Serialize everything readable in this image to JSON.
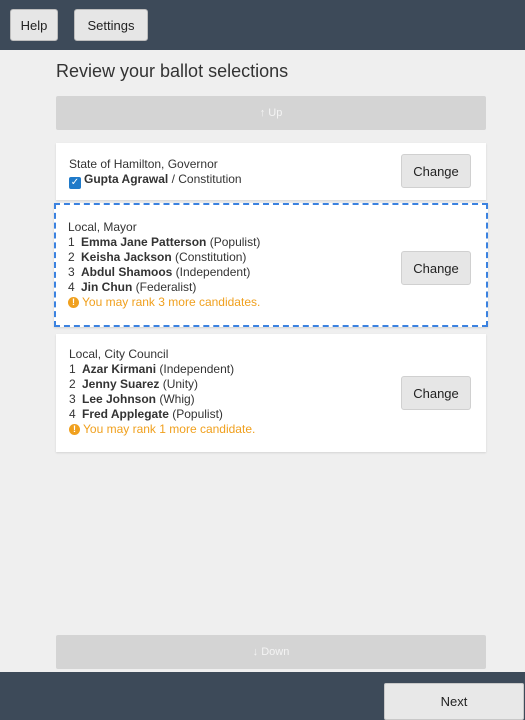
{
  "header": {
    "help_label": "Help",
    "settings_label": "Settings"
  },
  "page_title": "Review your ballot selections",
  "scroll_up_label": "Up",
  "scroll_down_label": "Down",
  "contests": [
    {
      "title": "State of Hamilton, Governor",
      "selection": {
        "name": "Gupta Agrawal",
        "party": " / Constitution"
      },
      "change_label": "Change"
    },
    {
      "title": "Local, Mayor",
      "rankings": [
        {
          "rank": "1",
          "name": "Emma Jane Patterson",
          "party": " (Populist)"
        },
        {
          "rank": "2",
          "name": "Keisha Jackson",
          "party": " (Constitution)"
        },
        {
          "rank": "3",
          "name": "Abdul Shamoos",
          "party": " (Independent)"
        },
        {
          "rank": "4",
          "name": "Jin Chun",
          "party": " (Federalist)"
        }
      ],
      "warning": "You may rank 3 more candidates.",
      "change_label": "Change"
    },
    {
      "title": "Local, City Council",
      "rankings": [
        {
          "rank": "1",
          "name": "Azar Kirmani",
          "party": " (Independent)"
        },
        {
          "rank": "2",
          "name": "Jenny Suarez",
          "party": " (Unity)"
        },
        {
          "rank": "3",
          "name": "Lee Johnson",
          "party": " (Whig)"
        },
        {
          "rank": "4",
          "name": "Fred Applegate",
          "party": " (Populist)"
        }
      ],
      "warning": "You may rank 1 more candidate.",
      "change_label": "Change"
    }
  ],
  "footer": {
    "next_label": "Next"
  },
  "colors": {
    "bar": "#3d4a59",
    "focus": "#3b82e0",
    "warning": "#f0a01e",
    "check": "#1f7ac9"
  }
}
